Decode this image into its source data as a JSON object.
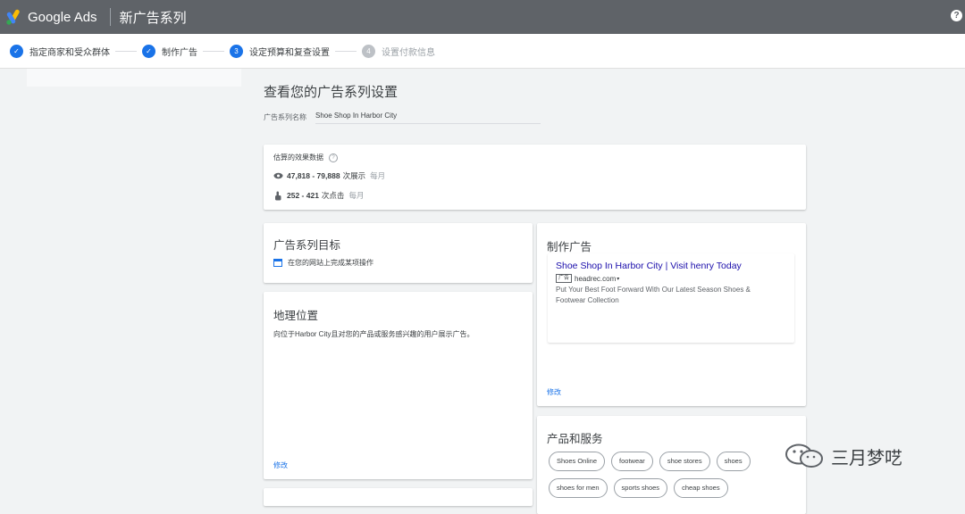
{
  "header": {
    "brand": "Google Ads",
    "title": "新广告系列",
    "help_icon": "help-icon",
    "colors": {
      "bar": "#5f6368",
      "accent": "#1a73e8"
    }
  },
  "stepper": {
    "steps": [
      {
        "label": "指定商家和受众群体",
        "status": "done",
        "marker": "✓"
      },
      {
        "label": "制作广告",
        "status": "done",
        "marker": "✓"
      },
      {
        "label": "设定预算和复查设置",
        "status": "active",
        "marker": "3"
      },
      {
        "label": "设置付款信息",
        "status": "pending",
        "marker": "4"
      }
    ]
  },
  "main": {
    "title": "查看您的广告系列设置",
    "name_label": "广告系列名称",
    "name_value": "Shoe Shop In Harbor City"
  },
  "estimate": {
    "title": "估算的效果数据",
    "info_icon": "info-icon",
    "impressions": {
      "icon": "eye-icon",
      "value": "47,818 - 79,888",
      "unit": "次展示",
      "period": "每月"
    },
    "clicks": {
      "icon": "pointer-icon",
      "value": "252 - 421",
      "unit": "次点击",
      "period": "每月"
    }
  },
  "goal": {
    "title": "广告系列目标",
    "icon": "web-icon",
    "text": "在您的网站上完成某项操作"
  },
  "location": {
    "title": "地理位置",
    "text": "向位于Harbor City且对您的产品或服务感兴趣的用户展示广告。",
    "edit": "修改"
  },
  "ad": {
    "title": "制作广告",
    "headline": "Shoe Shop In Harbor City | Visit henry Today",
    "badge": "广告",
    "url": "headrec.com",
    "description": "Put Your Best Foot Forward With Our Latest Season Shoes & Footwear Collection",
    "edit": "修改"
  },
  "products": {
    "title": "产品和服务",
    "chips": [
      "Shoes Online",
      "footwear",
      "shoe stores",
      "shoes",
      "shoes for men",
      "sports shoes",
      "cheap shoes"
    ]
  },
  "watermark": {
    "icon": "wechat-icon",
    "text": "三月梦呓"
  }
}
